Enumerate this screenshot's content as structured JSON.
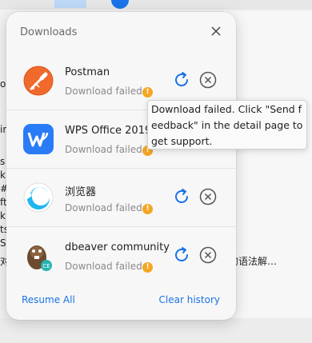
{
  "background": {
    "edge_chars": [
      "o",
      "in",
      "s",
      "k",
      "#",
      "ft",
      "k",
      "ts",
      "S",
      "对"
    ],
    "snippet": "的语法解…"
  },
  "panel": {
    "title": "Downloads",
    "items": [
      {
        "name": "Postman",
        "status": "Download failed",
        "warn": "!",
        "icon": "postman-app-icon"
      },
      {
        "name": "WPS Office 2019 F",
        "status": "Download failed",
        "warn": "!",
        "icon": "wps-office-app-icon"
      },
      {
        "name": "浏览器",
        "status": "Download failed",
        "warn": "!",
        "icon": "browser-app-icon"
      },
      {
        "name": "dbeaver community",
        "status": "Download failed",
        "warn": "!",
        "icon": "dbeaver-app-icon"
      }
    ],
    "footer": {
      "resume_all": "Resume All",
      "clear_history": "Clear history"
    }
  },
  "tooltip": {
    "text": "Download failed. Click \"Send feedback\" in the detail page to get support."
  },
  "colors": {
    "accent": "#1a73e8",
    "warning": "#f5a623",
    "panel_bg": "#f7f7f7"
  }
}
